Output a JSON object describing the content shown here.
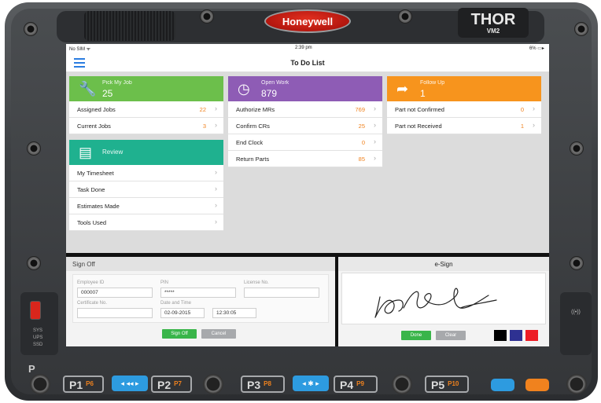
{
  "device": {
    "brand": "Honeywell",
    "model": "THOR",
    "model_sub": "VM2",
    "status_labels": [
      "SYS",
      "UPS",
      "SSD"
    ],
    "p_label": "P",
    "right_label": "((•))",
    "function_keys": [
      {
        "label": "P1",
        "sub": "P6"
      },
      {
        "label": "P2",
        "sub": "P7"
      },
      {
        "label": "P3",
        "sub": "P8"
      },
      {
        "label": "P4",
        "sub": "P9"
      },
      {
        "label": "P5",
        "sub": "P10"
      }
    ],
    "brightness_down": "◂ ◂◂ ▸",
    "brightness_up": "◂ ✱ ▸",
    "colors": {
      "accent_blue": "#2d9be0",
      "accent_orange": "#f0821e"
    }
  },
  "statusbar": {
    "carrier": "No SIM ᯤ",
    "time": "2:39 pm",
    "battery": "6% ▭▸"
  },
  "nav": {
    "title": "To Do List"
  },
  "cards": {
    "pick_my_job": {
      "title": "Pick My Job",
      "count": "25",
      "color": "#6cbf4b",
      "rows": [
        {
          "label": "Assigned Jobs",
          "value": "22"
        },
        {
          "label": "Current Jobs",
          "value": "3"
        }
      ]
    },
    "open_work": {
      "title": "Open Work",
      "count": "879",
      "color": "#8e5cb5",
      "rows": [
        {
          "label": "Authorize MRs",
          "value": "769"
        },
        {
          "label": "Confirm CRs",
          "value": "25"
        },
        {
          "label": "End Clock",
          "value": "0"
        },
        {
          "label": "Return Parts",
          "value": "85"
        }
      ]
    },
    "follow_up": {
      "title": "Follow Up",
      "count": "1",
      "color": "#f7941d",
      "rows": [
        {
          "label": "Part not Confirmed",
          "value": "0"
        },
        {
          "label": "Part not Received",
          "value": "1"
        }
      ]
    },
    "review": {
      "title": "Review",
      "color": "#1fb18f",
      "rows": [
        {
          "label": "My Timesheet"
        },
        {
          "label": "Task Done"
        },
        {
          "label": "Estimates Made"
        },
        {
          "label": "Tools Used"
        }
      ]
    }
  },
  "signoff": {
    "title": "Sign Off",
    "employee_id_label": "Employee ID",
    "employee_id": "000007",
    "pin_label": "PIN",
    "pin": "*****",
    "license_label": "License No.",
    "license": "",
    "certificate_label": "Certificate No.",
    "certificate": "",
    "datetime_label": "Date and Time",
    "date": "02-09-2015",
    "time": "12:30:05",
    "sign_off_button": "Sign Off",
    "cancel_button": "Cancel"
  },
  "esign": {
    "title": "e-Sign",
    "done_button": "Done",
    "clear_button": "Clear",
    "pen_colors": [
      "#000000",
      "#2e3192",
      "#ed1c24"
    ]
  }
}
